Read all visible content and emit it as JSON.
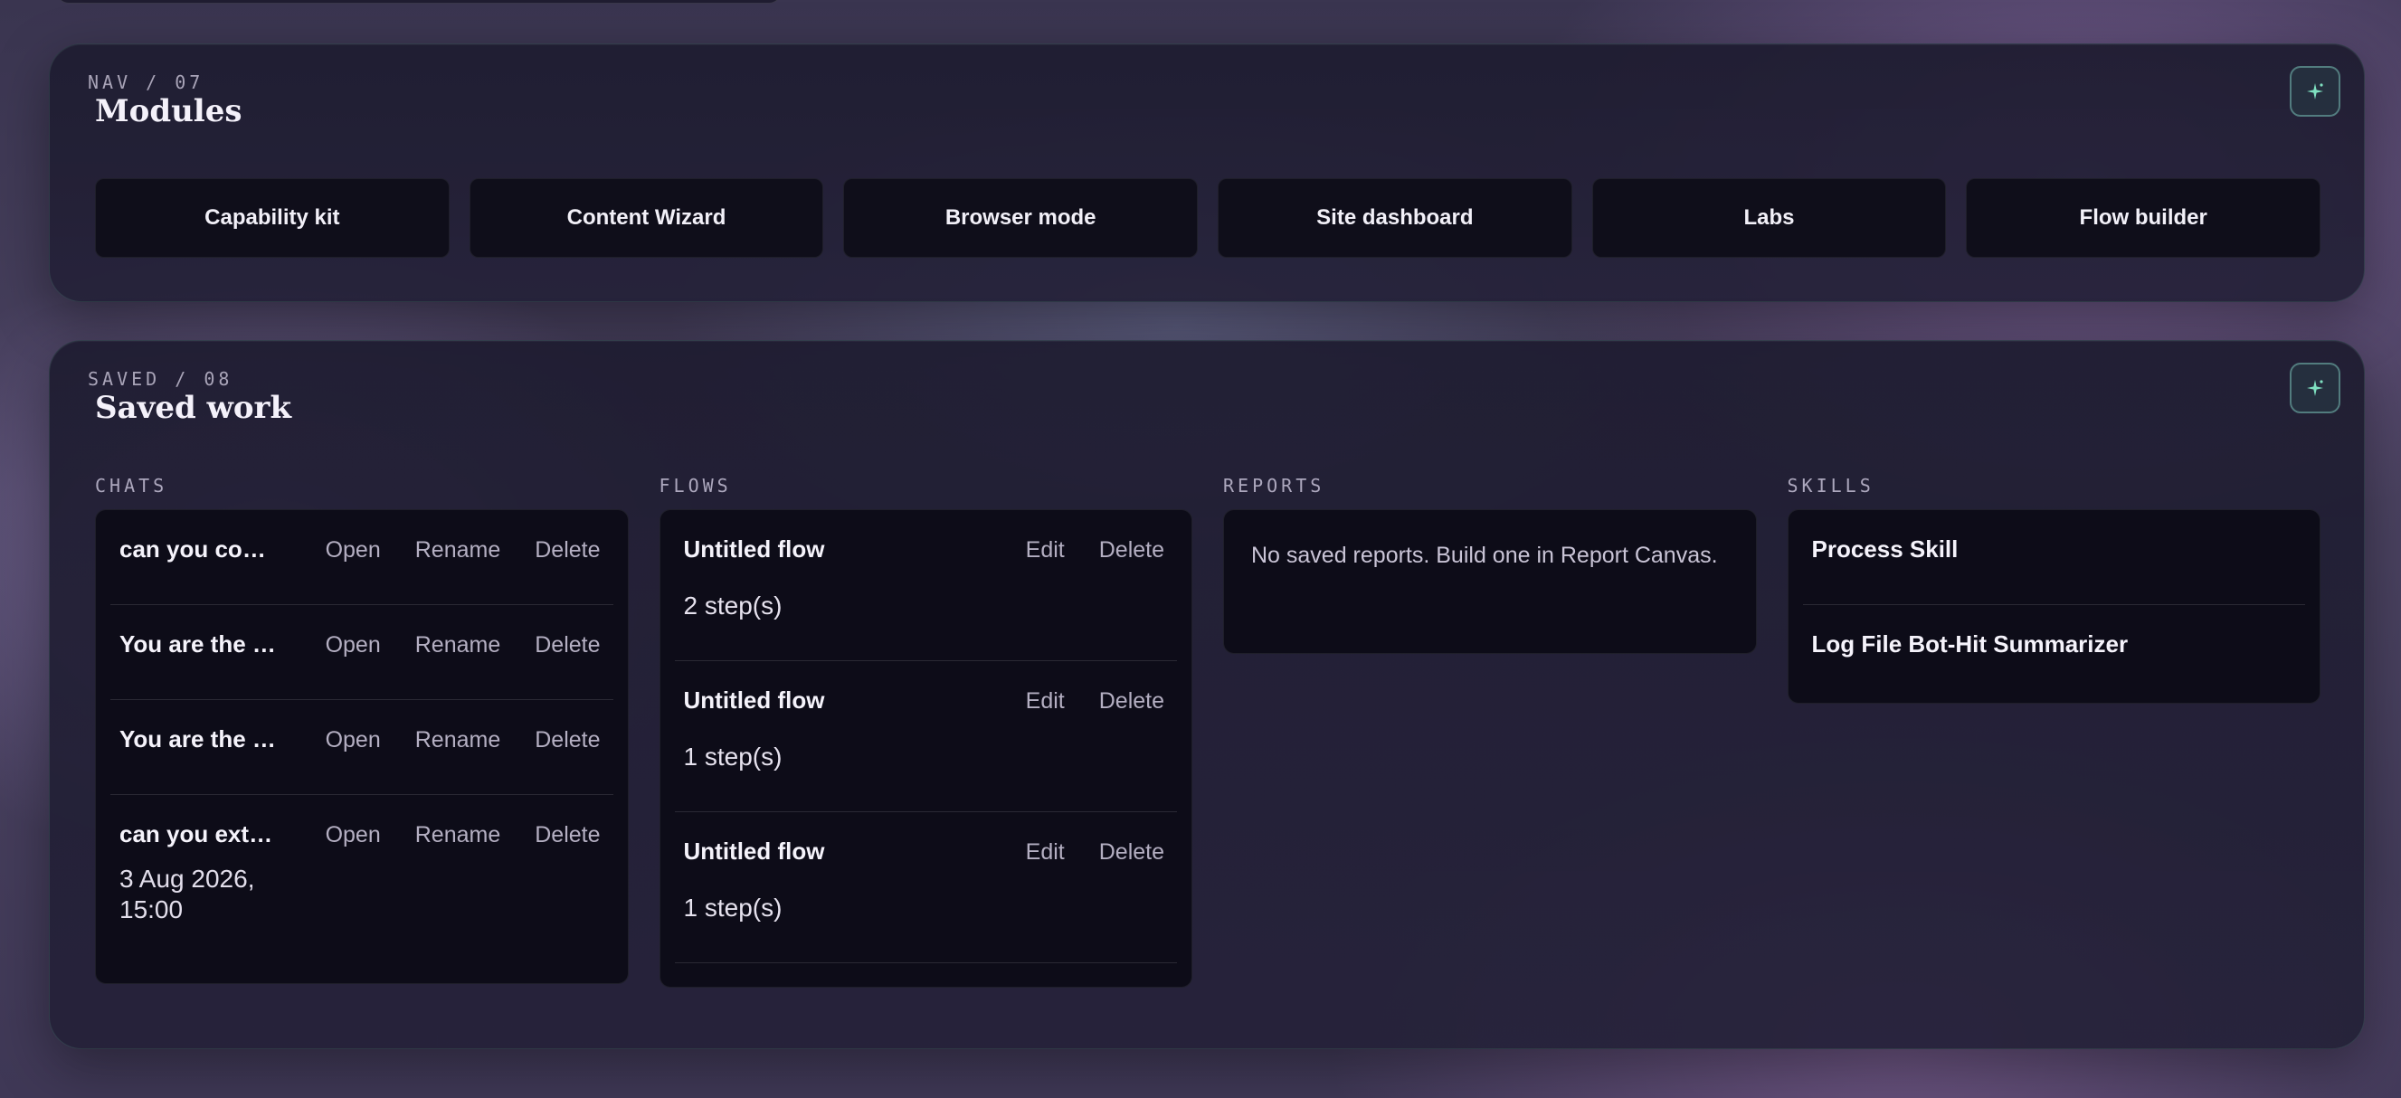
{
  "modules": {
    "eyebrow": "NAV / 07",
    "title": "Modules",
    "items": [
      {
        "label": "Capability kit"
      },
      {
        "label": "Content Wizard"
      },
      {
        "label": "Browser mode"
      },
      {
        "label": "Site dashboard"
      },
      {
        "label": "Labs"
      },
      {
        "label": "Flow builder"
      }
    ]
  },
  "saved": {
    "eyebrow": "SAVED / 08",
    "title": "Saved work",
    "chats": {
      "heading": "CHATS",
      "items": [
        {
          "title": "can you code something for me",
          "date": "",
          "open": "Open",
          "rename": "Rename",
          "delete": "Delete"
        },
        {
          "title": "You are the assistant",
          "date": "",
          "open": "Open",
          "rename": "Rename",
          "delete": "Delete"
        },
        {
          "title": "You are the assistant",
          "date": "",
          "open": "Open",
          "rename": "Rename",
          "delete": "Delete"
        },
        {
          "title": "can you extract the data",
          "date": "3 Aug 2026, 15:00",
          "open": "Open",
          "rename": "Rename",
          "delete": "Delete"
        }
      ]
    },
    "flows": {
      "heading": "FLOWS",
      "items": [
        {
          "title": "Untitled flow",
          "steps": "2 step(s)",
          "edit": "Edit",
          "delete": "Delete"
        },
        {
          "title": "Untitled flow",
          "steps": "1 step(s)",
          "edit": "Edit",
          "delete": "Delete"
        },
        {
          "title": "Untitled flow",
          "steps": "1 step(s)",
          "edit": "Edit",
          "delete": "Delete"
        }
      ]
    },
    "reports": {
      "heading": "REPORTS",
      "empty": "No saved reports. Build one in Report Canvas."
    },
    "skills": {
      "heading": "SKILLS",
      "items": [
        {
          "title": "Process Skill"
        },
        {
          "title": "Log File Bot-Hit Summarizer"
        }
      ]
    }
  },
  "icons": {
    "panel_action": "sparkle-icon"
  },
  "colors": {
    "accent": "#6fd0b4",
    "card_bg": "#0d0c18",
    "panel_bg": "#1e1c30"
  }
}
